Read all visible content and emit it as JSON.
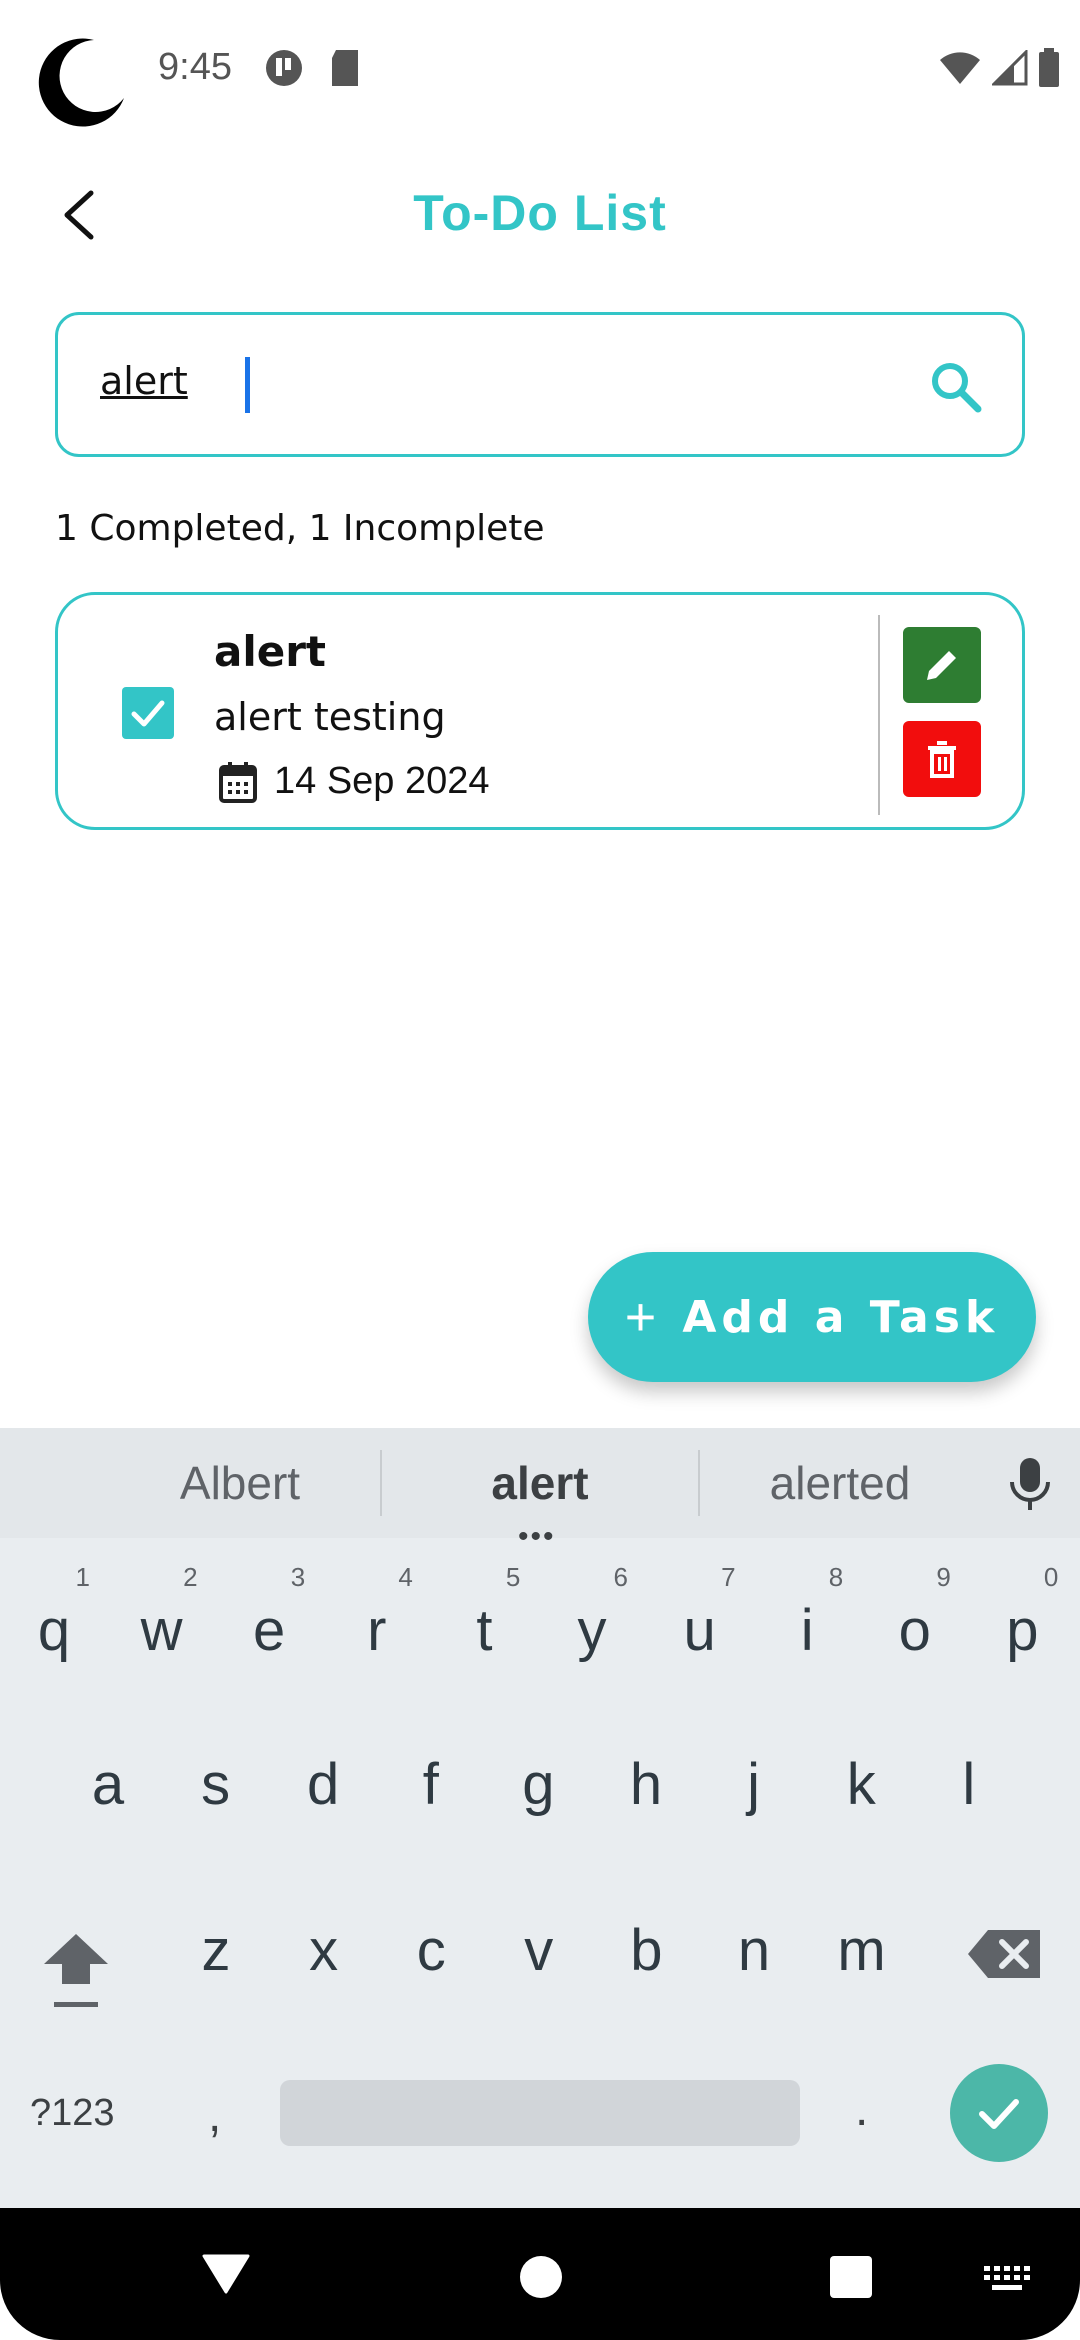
{
  "status_bar": {
    "time": "9:45",
    "icons": [
      "moon-icon",
      "app-notification-icon",
      "sd-card-icon",
      "wifi-icon",
      "signal-icon",
      "battery-icon"
    ]
  },
  "header": {
    "title": "To-Do List",
    "back_icon": "chevron-left-icon"
  },
  "search": {
    "value": "alert",
    "icon": "search-icon"
  },
  "summary": "1 Completed, 1 Incomplete",
  "tasks": [
    {
      "title": "alert",
      "description": "alert testing",
      "date": "14 Sep 2024",
      "completed": true
    }
  ],
  "fab": {
    "label": "Add a Task",
    "plus": "+"
  },
  "keyboard": {
    "suggestions": [
      "Albert",
      "alert",
      "alerted"
    ],
    "row1": [
      {
        "k": "q",
        "n": "1"
      },
      {
        "k": "w",
        "n": "2"
      },
      {
        "k": "e",
        "n": "3"
      },
      {
        "k": "r",
        "n": "4"
      },
      {
        "k": "t",
        "n": "5"
      },
      {
        "k": "y",
        "n": "6"
      },
      {
        "k": "u",
        "n": "7"
      },
      {
        "k": "i",
        "n": "8"
      },
      {
        "k": "o",
        "n": "9"
      },
      {
        "k": "p",
        "n": "0"
      }
    ],
    "row2": [
      "a",
      "s",
      "d",
      "f",
      "g",
      "h",
      "j",
      "k",
      "l"
    ],
    "row3": [
      "z",
      "x",
      "c",
      "v",
      "b",
      "n",
      "m"
    ],
    "symbols_label": "?123",
    "comma": ",",
    "period": "."
  },
  "colors": {
    "accent": "#33c5c7",
    "edit": "#2e7d32",
    "delete": "#f20d0d",
    "enter_key": "#4cb7a8"
  }
}
